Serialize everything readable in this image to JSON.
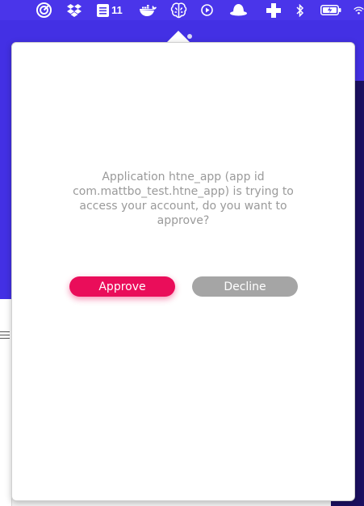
{
  "menubar": {
    "icons": [
      "focus-icon",
      "dropbox-icon",
      "tasks-icon",
      "docker-icon",
      "brain-icon",
      "play-circle-icon",
      "hat-icon",
      "medical-cross-icon",
      "bluetooth-icon",
      "battery-icon",
      "wifi-icon"
    ],
    "tasks_count": "11"
  },
  "dialog": {
    "message": "Application htne_app (app id com.mattbo_test.htne_app) is trying to access your account, do you want to approve?",
    "approve_label": "Approve",
    "decline_label": "Decline"
  },
  "colors": {
    "approve": "#ea0d5a",
    "decline": "#a5a5a5",
    "desktop": "#4330e4"
  }
}
